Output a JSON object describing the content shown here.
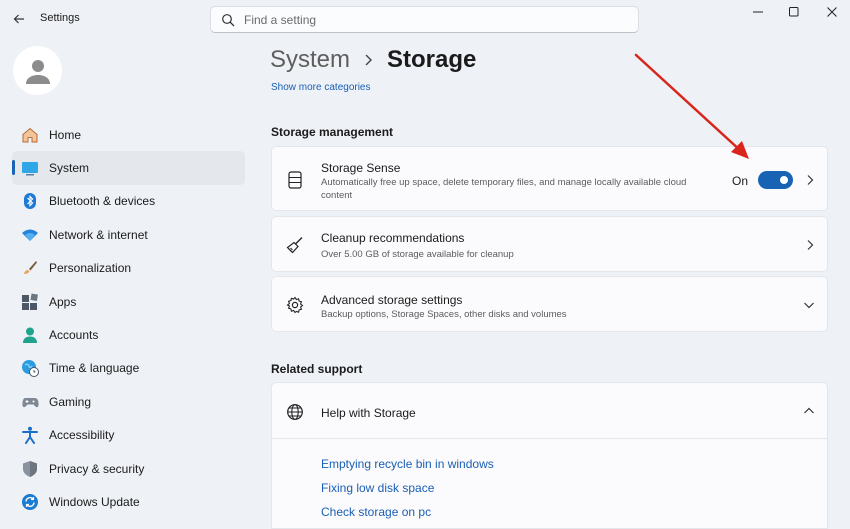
{
  "app": {
    "title": "Settings"
  },
  "search": {
    "placeholder": "Find a setting"
  },
  "sidebar": {
    "items": [
      {
        "label": "Home",
        "icon": "home-icon"
      },
      {
        "label": "System",
        "icon": "system-icon",
        "selected": true
      },
      {
        "label": "Bluetooth & devices",
        "icon": "bluetooth-icon"
      },
      {
        "label": "Network & internet",
        "icon": "wifi-icon"
      },
      {
        "label": "Personalization",
        "icon": "brush-icon"
      },
      {
        "label": "Apps",
        "icon": "apps-icon"
      },
      {
        "label": "Accounts",
        "icon": "accounts-icon"
      },
      {
        "label": "Time & language",
        "icon": "globe-clock-icon"
      },
      {
        "label": "Gaming",
        "icon": "gamepad-icon"
      },
      {
        "label": "Accessibility",
        "icon": "accessibility-icon"
      },
      {
        "label": "Privacy & security",
        "icon": "shield-icon"
      },
      {
        "label": "Windows Update",
        "icon": "update-icon"
      }
    ]
  },
  "breadcrumb": {
    "parent": "System",
    "current": "Storage"
  },
  "show_more": "Show more categories",
  "storage_management": {
    "title": "Storage management",
    "storage_sense": {
      "title": "Storage Sense",
      "description_line1": "Automatically free up space, delete temporary files, and manage locally available cloud",
      "description_line2": "content",
      "toggle_label": "On",
      "toggle_on": true
    },
    "cleanup": {
      "title": "Cleanup recommendations",
      "description": "Over 5.00 GB of storage available for cleanup"
    },
    "advanced": {
      "title": "Advanced storage settings",
      "description": "Backup options, Storage Spaces, other disks and volumes"
    }
  },
  "related_support": {
    "title": "Related support",
    "help": {
      "title": "Help with Storage",
      "links": [
        "Emptying recycle bin in windows",
        "Fixing low disk space",
        "Check storage on pc"
      ]
    }
  },
  "colors": {
    "accent": "#1863b3",
    "link": "#1a5fb4",
    "annotation_arrow": "#d9261c"
  }
}
